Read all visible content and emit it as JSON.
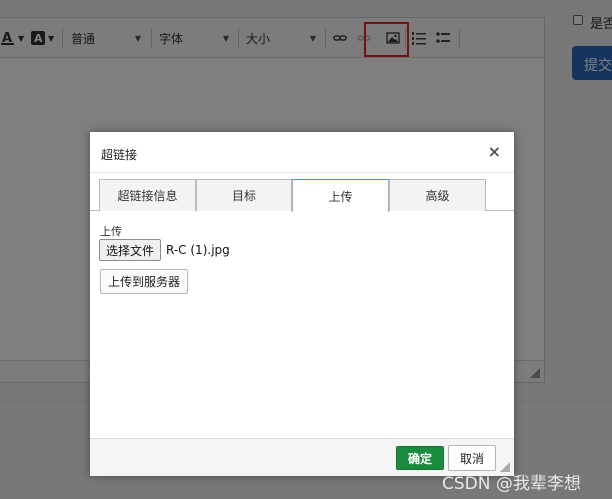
{
  "toolbar": {
    "font_color_icon": "font-color-icon",
    "bg_color_icon": "background-color-icon",
    "format_combo": "普通",
    "font_combo": "字体",
    "size_combo": "大小",
    "link_icon": "link-icon",
    "unlink_icon": "unlink-icon",
    "image_icon": "image-icon",
    "numbered_list_icon": "numbered-list-icon",
    "bulleted_list_icon": "bulleted-list-icon"
  },
  "side": {
    "checkbox_label": "是否",
    "submit_label": "提交"
  },
  "dialog": {
    "title": "超链接",
    "close_symbol": "×",
    "tabs": [
      {
        "label": "超链接信息",
        "active": false
      },
      {
        "label": "目标",
        "active": false
      },
      {
        "label": "上传",
        "active": true
      },
      {
        "label": "高级",
        "active": false
      }
    ],
    "upload_label": "上传",
    "choose_file_label": "选择文件",
    "file_name": "R-C (1).jpg",
    "upload_server_label": "上传到服务器",
    "ok_label": "确定",
    "cancel_label": "取消"
  },
  "watermark": "CSDN @我辈李想",
  "colors": {
    "overlay": "rgba(0,0,0,0.5)",
    "highlight_box": "#e5231c",
    "ok_button": "#1a8a3e",
    "submit_button": "#2a6bbd",
    "active_tab_border": "#3a96c8"
  }
}
